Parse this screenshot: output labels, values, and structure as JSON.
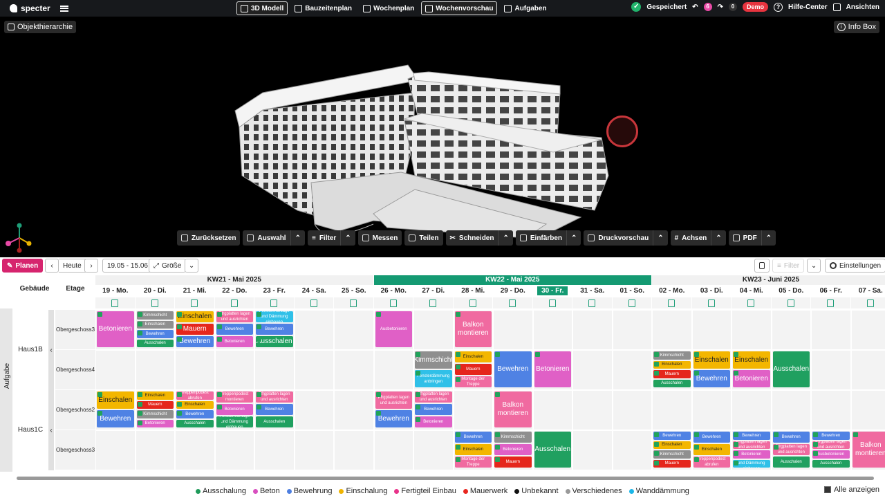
{
  "app": {
    "name": "specter"
  },
  "nav": {
    "tabs": [
      {
        "label": "3D Modell",
        "active": true
      },
      {
        "label": "Bauzeitenplan",
        "active": false
      },
      {
        "label": "Wochenplan",
        "active": false
      },
      {
        "label": "Wochenvorschau",
        "active": true
      },
      {
        "label": "Aufgaben",
        "active": false
      }
    ]
  },
  "status": {
    "saved": "Gespeichert",
    "undo_count": "6",
    "redo_count": "0",
    "badge": "Demo"
  },
  "topright": {
    "help": "Hilfe-Center",
    "views": "Ansichten"
  },
  "viewer": {
    "hierarchy": "Objekthierarchie",
    "info": "Info Box"
  },
  "toolbar3d": [
    {
      "label": "Zurücksetzen",
      "chevron": false
    },
    {
      "label": "Auswahl",
      "chevron": true
    },
    {
      "label": "Filter",
      "chevron": true
    },
    {
      "label": "Messen",
      "chevron": false
    },
    {
      "label": "Teilen",
      "chevron": false
    },
    {
      "label": "Schneiden",
      "chevron": true
    },
    {
      "label": "Einfärben",
      "chevron": true
    },
    {
      "label": "Druckvorschau",
      "chevron": true
    },
    {
      "label": "Achsen",
      "chevron": true
    },
    {
      "label": "PDF",
      "chevron": true
    }
  ],
  "planbar": {
    "plan": "Planen",
    "today": "Heute",
    "range": "19.05 - 15.06",
    "size": "Größe",
    "filter": "Filter",
    "settings": "Einstellungen"
  },
  "grid": {
    "headers": {
      "building": "Gebäude",
      "floor": "Etage"
    },
    "sidebar": "Aufgabe",
    "weeks": [
      {
        "label": "KW21 - Mai 2025",
        "current": false
      },
      {
        "label": "KW22 - Mai 2025",
        "current": true
      },
      {
        "label": "KW23 - Juni 2025",
        "current": false
      }
    ],
    "days": [
      "19 - Mo.",
      "20 - Di.",
      "21 - Mi.",
      "22 - Do.",
      "23 - Fr.",
      "24 - Sa.",
      "25 - So.",
      "26 - Mo.",
      "27 - Di.",
      "28 - Mi.",
      "29 - Do.",
      "30 - Fr.",
      "31 - Sa.",
      "01 - So.",
      "02 - Mo.",
      "03 - Di.",
      "04 - Mi.",
      "05 - Do.",
      "06 - Fr.",
      "07 - Sa."
    ],
    "today_index": 11,
    "buildings": [
      {
        "name": "Haus1B",
        "floors": [
          "Obergeschoss3",
          "Obergeschoss4"
        ]
      },
      {
        "name": "Haus1C",
        "floors": [
          "Obergeschoss2",
          "Obergeschoss3"
        ]
      }
    ],
    "tasks": [
      {
        "row": 0,
        "day": 0,
        "slot": [
          0,
          2
        ],
        "label": "Betonieren",
        "cat": "Beton",
        "big": true
      },
      {
        "row": 0,
        "day": 1,
        "slot": [
          0,
          0.5
        ],
        "label": "Kimmschicht",
        "cat": "Unbekannt"
      },
      {
        "row": 0,
        "day": 1,
        "slot": [
          0.5,
          1
        ],
        "label": "Einschalen",
        "cat": "Unbekannt"
      },
      {
        "row": 0,
        "day": 1,
        "slot": [
          1,
          1.5
        ],
        "label": "Bewehren",
        "cat": "Bewehrung"
      },
      {
        "row": 0,
        "day": 1,
        "slot": [
          1.5,
          2
        ],
        "label": "Ausschalen",
        "cat": "Ausschalung"
      },
      {
        "row": 0,
        "day": 2,
        "slot": [
          0,
          0.66
        ],
        "label": "Einschalen",
        "cat": "Einschalung",
        "big": true
      },
      {
        "row": 0,
        "day": 2,
        "slot": [
          0.66,
          1.33
        ],
        "label": "Mauern",
        "cat": "Mauerwerk",
        "big": true
      },
      {
        "row": 0,
        "day": 2,
        "slot": [
          1.33,
          2
        ],
        "label": "Bewehren",
        "cat": "Bewehrung",
        "big": true
      },
      {
        "row": 0,
        "day": 3,
        "slot": [
          0,
          0.66
        ],
        "label": "Pfrgplatten lagen und ausrichten",
        "cat": "Fertigteil Einbau"
      },
      {
        "row": 0,
        "day": 3,
        "slot": [
          0.66,
          1.33
        ],
        "label": "Bewehren",
        "cat": "Bewehrung"
      },
      {
        "row": 0,
        "day": 3,
        "slot": [
          1.33,
          2
        ],
        "label": "Betonieren",
        "cat": "Beton"
      },
      {
        "row": 0,
        "day": 4,
        "slot": [
          0,
          0.66
        ],
        "label": "Fenstermontage und Dämmung einbauen",
        "cat": "Wanddämmung"
      },
      {
        "row": 0,
        "day": 4,
        "slot": [
          0.66,
          1.33
        ],
        "label": "Bewehren",
        "cat": "Bewehrung"
      },
      {
        "row": 0,
        "day": 4,
        "slot": [
          1.33,
          2
        ],
        "label": "Ausschalen",
        "cat": "Ausschalung",
        "big": true
      },
      {
        "row": 0,
        "day": 7,
        "slot": [
          0,
          2
        ],
        "label": "Ausbetonieren",
        "cat": "Beton"
      },
      {
        "row": 0,
        "day": 9,
        "slot": [
          0,
          2
        ],
        "label": "Balkon montieren",
        "cat": "Fertigteil Einbau",
        "big": true
      },
      {
        "row": 1,
        "day": 8,
        "slot": [
          0,
          1
        ],
        "label": "Kimmschicht",
        "cat": "Unbekannt",
        "big": true
      },
      {
        "row": 1,
        "day": 8,
        "slot": [
          1,
          2
        ],
        "label": "Fensterdämmung anbringen",
        "cat": "Wanddämmung"
      },
      {
        "row": 1,
        "day": 9,
        "slot": [
          0,
          0.66
        ],
        "label": "Einschalen",
        "cat": "Einschalung"
      },
      {
        "row": 1,
        "day": 9,
        "slot": [
          0.66,
          1.33
        ],
        "label": "Mauern",
        "cat": "Mauerwerk"
      },
      {
        "row": 1,
        "day": 9,
        "slot": [
          1.33,
          2
        ],
        "label": "Montage der Treppe",
        "cat": "Fertigteil Einbau"
      },
      {
        "row": 1,
        "day": 10,
        "slot": [
          0,
          2
        ],
        "label": "Bewehren",
        "cat": "Bewehrung",
        "big": true
      },
      {
        "row": 1,
        "day": 11,
        "slot": [
          0,
          2
        ],
        "label": "Betonieren",
        "cat": "Beton",
        "big": true
      },
      {
        "row": 1,
        "day": 14,
        "slot": [
          0,
          0.5
        ],
        "label": "Kimmschicht",
        "cat": "Unbekannt"
      },
      {
        "row": 1,
        "day": 14,
        "slot": [
          0.5,
          1
        ],
        "label": "Einschalen",
        "cat": "Einschalung"
      },
      {
        "row": 1,
        "day": 14,
        "slot": [
          1,
          1.5
        ],
        "label": "Mauern",
        "cat": "Mauerwerk"
      },
      {
        "row": 1,
        "day": 14,
        "slot": [
          1.5,
          2
        ],
        "label": "Ausschalen",
        "cat": "Ausschalung"
      },
      {
        "row": 1,
        "day": 15,
        "slot": [
          0,
          1
        ],
        "label": "Einschalen",
        "cat": "Einschalung",
        "big": true
      },
      {
        "row": 1,
        "day": 15,
        "slot": [
          1,
          2
        ],
        "label": "Bewehren",
        "cat": "Bewehrung",
        "big": true
      },
      {
        "row": 1,
        "day": 16,
        "slot": [
          0,
          1
        ],
        "label": "Einschalen",
        "cat": "Einschalung",
        "big": true
      },
      {
        "row": 1,
        "day": 16,
        "slot": [
          1,
          2
        ],
        "label": "Betonieren",
        "cat": "Beton",
        "big": true
      },
      {
        "row": 1,
        "day": 17,
        "slot": [
          0,
          2
        ],
        "label": "Ausschalen",
        "cat": "Ausschalung",
        "big": true
      },
      {
        "row": 2,
        "day": 0,
        "slot": [
          0,
          1
        ],
        "label": "Einschalen",
        "cat": "Einschalung",
        "big": true
      },
      {
        "row": 2,
        "day": 0,
        "slot": [
          1,
          2
        ],
        "label": "Bewehren",
        "cat": "Bewehrung",
        "big": true
      },
      {
        "row": 2,
        "day": 1,
        "slot": [
          0,
          0.5
        ],
        "label": "Einschalen",
        "cat": "Einschalung"
      },
      {
        "row": 2,
        "day": 1,
        "slot": [
          0.5,
          1
        ],
        "label": "Mauern",
        "cat": "Mauerwerk"
      },
      {
        "row": 2,
        "day": 1,
        "slot": [
          1,
          1.5
        ],
        "label": "Kimmschicht",
        "cat": "Unbekannt"
      },
      {
        "row": 2,
        "day": 1,
        "slot": [
          1.5,
          2
        ],
        "label": "Betonieren",
        "cat": "Beton"
      },
      {
        "row": 2,
        "day": 2,
        "slot": [
          0,
          0.5
        ],
        "label": "Treppenpodest abrufen",
        "cat": "Fertigteil Einbau"
      },
      {
        "row": 2,
        "day": 2,
        "slot": [
          0.5,
          1
        ],
        "label": "Einschalen",
        "cat": "Einschalung"
      },
      {
        "row": 2,
        "day": 2,
        "slot": [
          1,
          1.5
        ],
        "label": "Bewehren",
        "cat": "Bewehrung"
      },
      {
        "row": 2,
        "day": 2,
        "slot": [
          1.5,
          2
        ],
        "label": "Ausschalen",
        "cat": "Ausschalung"
      },
      {
        "row": 2,
        "day": 3,
        "slot": [
          0,
          0.66
        ],
        "label": "Treppenpodest montieren",
        "cat": "Fertigteil Einbau"
      },
      {
        "row": 2,
        "day": 3,
        "slot": [
          0.66,
          1.33
        ],
        "label": "Betonieren",
        "cat": "Beton"
      },
      {
        "row": 2,
        "day": 3,
        "slot": [
          1.33,
          2
        ],
        "label": "Fenstermontage und Dämmung einbauen",
        "cat": "Ausschalung"
      },
      {
        "row": 2,
        "day": 4,
        "slot": [
          0,
          0.66
        ],
        "label": "Pfrgplatten lagen und ausrichten",
        "cat": "Fertigteil Einbau"
      },
      {
        "row": 2,
        "day": 4,
        "slot": [
          0.66,
          1.33
        ],
        "label": "Bewehren",
        "cat": "Bewehrung"
      },
      {
        "row": 2,
        "day": 4,
        "slot": [
          1.33,
          2
        ],
        "label": "Ausschalen",
        "cat": "Ausschalung"
      },
      {
        "row": 2,
        "day": 7,
        "slot": [
          0,
          1
        ],
        "label": "Pfrgplatten lagen und ausrichten",
        "cat": "Fertigteil Einbau"
      },
      {
        "row": 2,
        "day": 7,
        "slot": [
          1,
          2
        ],
        "label": "Bewehren",
        "cat": "Bewehrung",
        "big": true
      },
      {
        "row": 2,
        "day": 8,
        "slot": [
          0,
          0.66
        ],
        "label": "Pfrgplatten lagen und ausrichten",
        "cat": "Fertigteil Einbau"
      },
      {
        "row": 2,
        "day": 8,
        "slot": [
          0.66,
          1.33
        ],
        "label": "Bewehren",
        "cat": "Bewehrung"
      },
      {
        "row": 2,
        "day": 8,
        "slot": [
          1.33,
          2
        ],
        "label": "Betonieren",
        "cat": "Beton"
      },
      {
        "row": 2,
        "day": 10,
        "slot": [
          0,
          2
        ],
        "label": "Balkon montieren",
        "cat": "Fertigteil Einbau",
        "big": true
      },
      {
        "row": 3,
        "day": 9,
        "slot": [
          0,
          0.66
        ],
        "label": "Bewehren",
        "cat": "Bewehrung"
      },
      {
        "row": 3,
        "day": 9,
        "slot": [
          0.66,
          1.33
        ],
        "label": "Einschalen",
        "cat": "Einschalung"
      },
      {
        "row": 3,
        "day": 9,
        "slot": [
          1.33,
          2
        ],
        "label": "Montage der Treppe",
        "cat": "Fertigteil Einbau"
      },
      {
        "row": 3,
        "day": 10,
        "slot": [
          0,
          0.66
        ],
        "label": "Kimmschicht",
        "cat": "Unbekannt"
      },
      {
        "row": 3,
        "day": 10,
        "slot": [
          0.66,
          1.33
        ],
        "label": "Betonieren",
        "cat": "Beton"
      },
      {
        "row": 3,
        "day": 10,
        "slot": [
          1.33,
          2
        ],
        "label": "Mauern",
        "cat": "Mauerwerk"
      },
      {
        "row": 3,
        "day": 11,
        "slot": [
          0,
          2
        ],
        "label": "Ausschalen",
        "cat": "Ausschalung",
        "big": true
      },
      {
        "row": 3,
        "day": 14,
        "slot": [
          0,
          0.5
        ],
        "label": "Bewehren",
        "cat": "Bewehrung"
      },
      {
        "row": 3,
        "day": 14,
        "slot": [
          0.5,
          1
        ],
        "label": "Einschalen",
        "cat": "Einschalung"
      },
      {
        "row": 3,
        "day": 14,
        "slot": [
          1,
          1.5
        ],
        "label": "Kimmschicht",
        "cat": "Unbekannt"
      },
      {
        "row": 3,
        "day": 14,
        "slot": [
          1.5,
          2
        ],
        "label": "Mauern",
        "cat": "Mauerwerk"
      },
      {
        "row": 3,
        "day": 15,
        "slot": [
          0,
          0.66
        ],
        "label": "Bewehren",
        "cat": "Bewehrung"
      },
      {
        "row": 3,
        "day": 15,
        "slot": [
          0.66,
          1.33
        ],
        "label": "Einschalen",
        "cat": "Einschalung"
      },
      {
        "row": 3,
        "day": 15,
        "slot": [
          1.33,
          2
        ],
        "label": "Treppenpodest abrufen",
        "cat": "Fertigteil Einbau"
      },
      {
        "row": 3,
        "day": 16,
        "slot": [
          0,
          0.5
        ],
        "label": "Bewehren",
        "cat": "Bewehrung"
      },
      {
        "row": 3,
        "day": 16,
        "slot": [
          0.5,
          1
        ],
        "label": "Pfrgplatten lagen und ausrichten",
        "cat": "Fertigteil Einbau"
      },
      {
        "row": 3,
        "day": 16,
        "slot": [
          1,
          1.5
        ],
        "label": "Betonieren",
        "cat": "Beton"
      },
      {
        "row": 3,
        "day": 16,
        "slot": [
          1.5,
          2
        ],
        "label": "Fenstermontage und Dämmung einbauen",
        "cat": "Wanddämmung"
      },
      {
        "row": 3,
        "day": 17,
        "slot": [
          0,
          0.66
        ],
        "label": "Bewehren",
        "cat": "Bewehrung"
      },
      {
        "row": 3,
        "day": 17,
        "slot": [
          0.66,
          1.33
        ],
        "label": "Pfrgplatten lagen und ausrichten",
        "cat": "Fertigteil Einbau"
      },
      {
        "row": 3,
        "day": 17,
        "slot": [
          1.33,
          2
        ],
        "label": "Ausschalen",
        "cat": "Ausschalung"
      },
      {
        "row": 3,
        "day": 18,
        "slot": [
          0,
          0.5
        ],
        "label": "Bewehren",
        "cat": "Bewehrung"
      },
      {
        "row": 3,
        "day": 18,
        "slot": [
          0.5,
          1
        ],
        "label": "Pfrgplatten lagen und ausrichten",
        "cat": "Fertigteil Einbau"
      },
      {
        "row": 3,
        "day": 18,
        "slot": [
          1,
          1.5
        ],
        "label": "Ausbetonieren",
        "cat": "Beton"
      },
      {
        "row": 3,
        "day": 18,
        "slot": [
          1.5,
          2
        ],
        "label": "Ausschalen",
        "cat": "Ausschalung"
      },
      {
        "row": 3,
        "day": 19,
        "slot": [
          0,
          2
        ],
        "label": "Balkon montieren",
        "cat": "Fertigteil Einbau",
        "big": true
      }
    ]
  },
  "legend": {
    "items": [
      {
        "label": "Ausschalung",
        "color": "#1f9a5a"
      },
      {
        "label": "Beton",
        "color": "#d84fbf"
      },
      {
        "label": "Bewehrung",
        "color": "#4e7fe0"
      },
      {
        "label": "Einschalung",
        "color": "#f0b400"
      },
      {
        "label": "Fertigteil Einbau",
        "color": "#e8338a"
      },
      {
        "label": "Mauerwerk",
        "color": "#e8261f"
      },
      {
        "label": "Unbekannt",
        "color": "#111111"
      },
      {
        "label": "Verschiedenes",
        "color": "#999999"
      },
      {
        "label": "Wanddämmung",
        "color": "#1ab6e8"
      }
    ],
    "show_all": "Alle anzeigen"
  },
  "colors": {
    "accent": "#149a72",
    "plan_button": "#d6246e",
    "cat_fill": {
      "Ausschalung": "#20a060",
      "Beton": "#e060c6",
      "Bewehrung": "#4f82e4",
      "Einschalung": "#f3b600",
      "Fertigteil Einbau": "#f06aa0",
      "Mauerwerk": "#e5261c",
      "Unbekannt": "#8f8f8f",
      "Wanddämmung": "#30c0e8"
    }
  }
}
